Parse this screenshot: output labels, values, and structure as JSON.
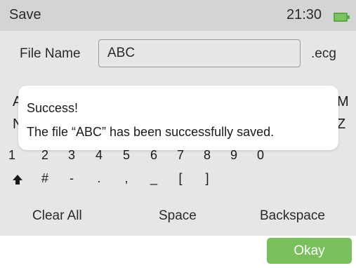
{
  "status_bar": {
    "title": "Save",
    "time": "21:30",
    "battery_icon": "battery-icon",
    "battery_color": "#7cc35f"
  },
  "file_name": {
    "label": "File Name",
    "value": "ABC",
    "extension": ".ecg"
  },
  "keyboard": {
    "partial_letters_left": [
      "A",
      "N"
    ],
    "partial_letters_right": [
      "M",
      "Z"
    ],
    "number_row": [
      "1",
      "2",
      "3",
      "4",
      "5",
      "6",
      "7",
      "8",
      "9",
      "0"
    ],
    "symbol_row": [
      "#",
      "-",
      ".",
      ",",
      "_",
      "[",
      "]"
    ],
    "shift_icon": "shift-up-arrow-icon"
  },
  "actions": {
    "clear_all": "Clear All",
    "space": "Space",
    "backspace": "Backspace",
    "okay": "Okay",
    "okay_color": "#79c05c"
  },
  "dialog": {
    "title": "Success!",
    "message": "The file “ABC” has been successfully saved."
  }
}
